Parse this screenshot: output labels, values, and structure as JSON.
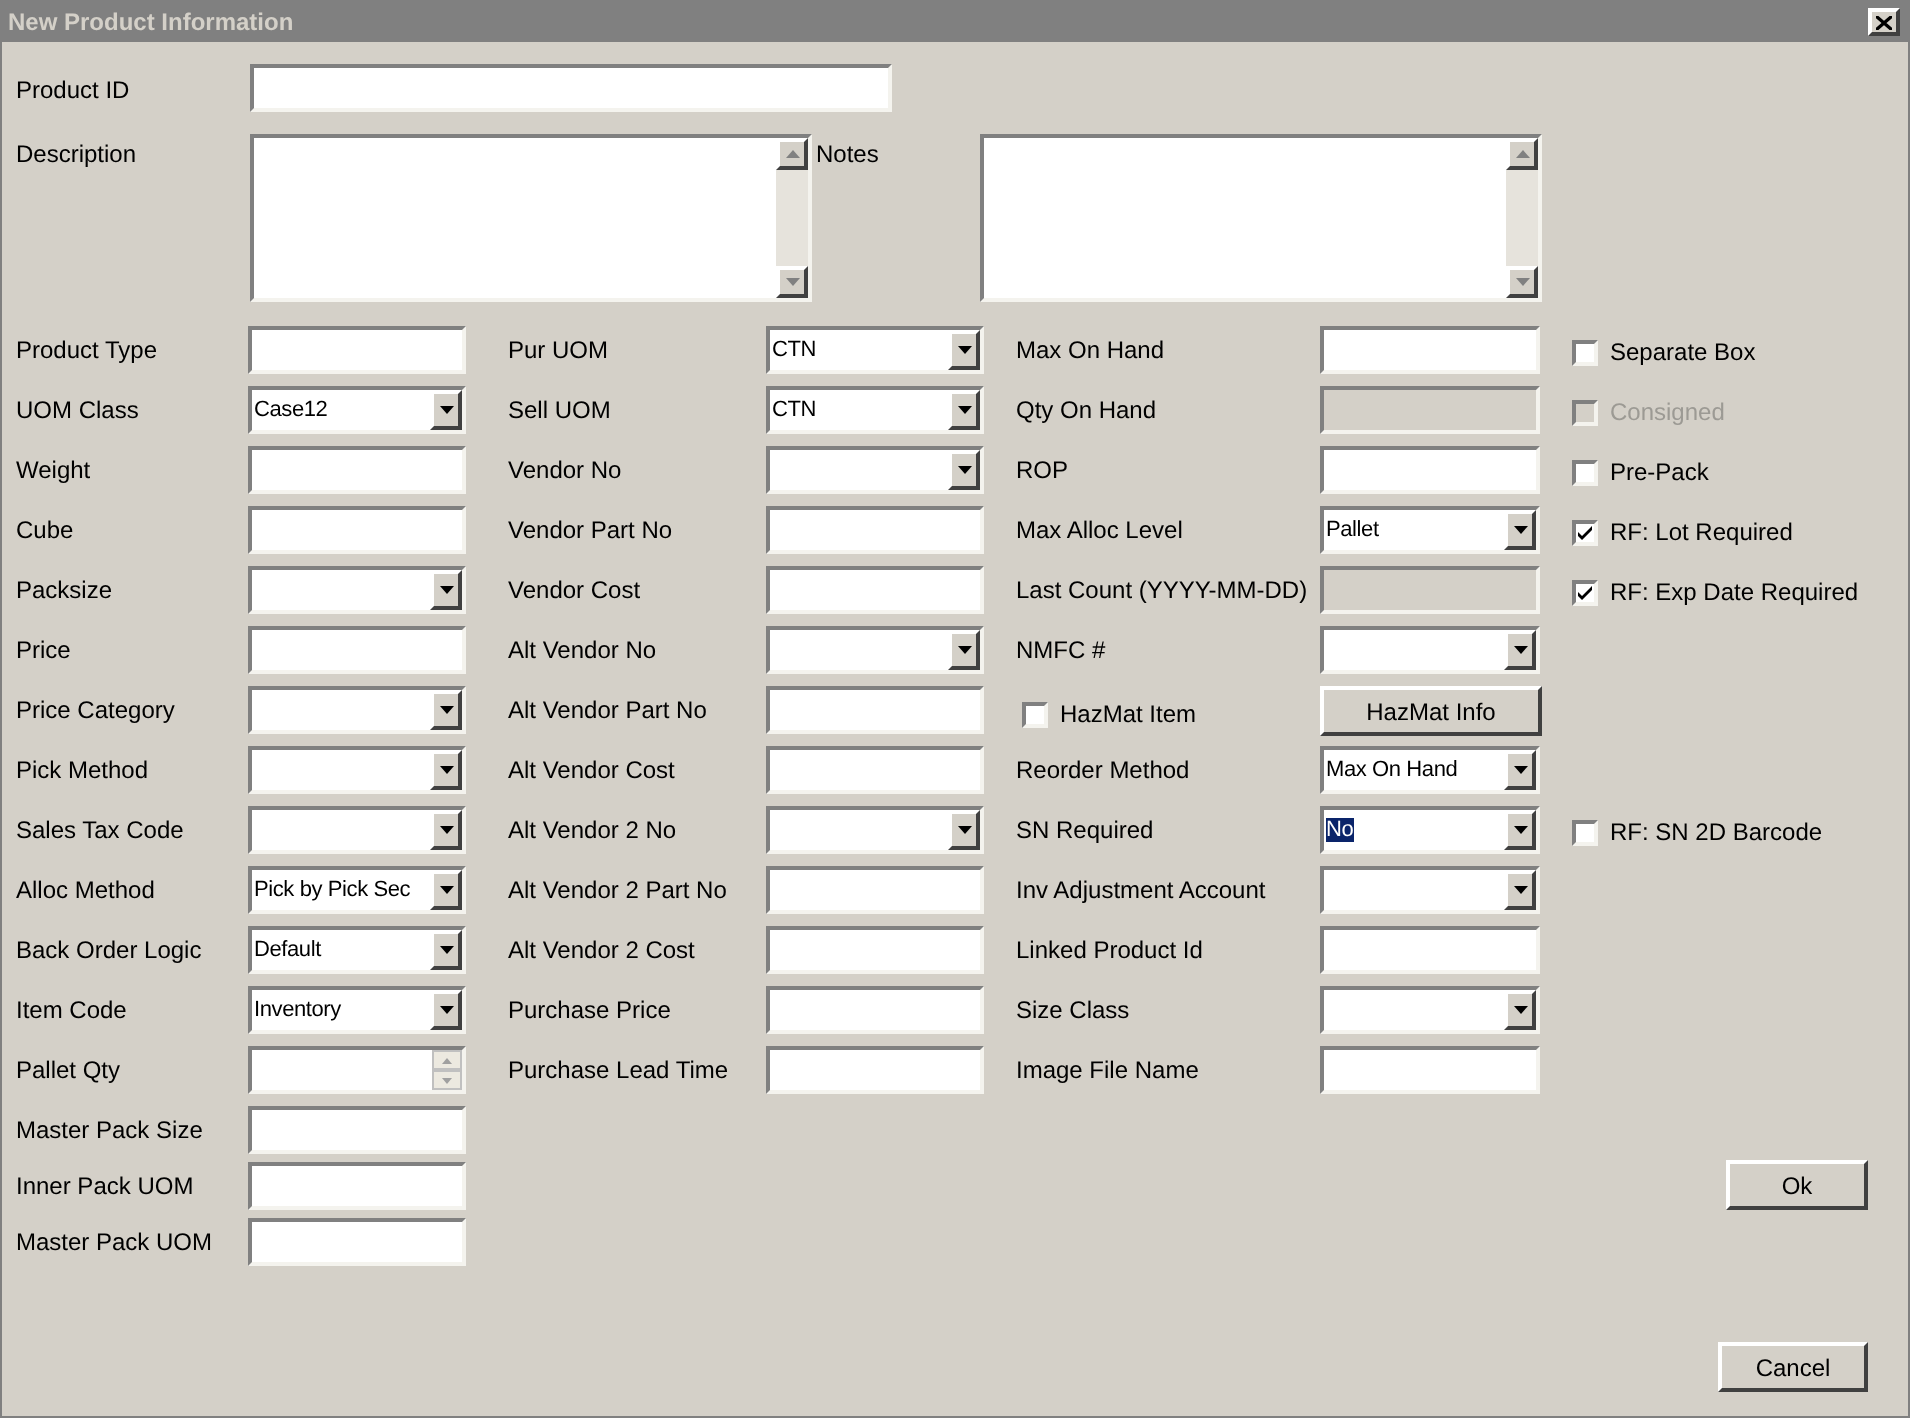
{
  "window": {
    "title": "New Product Information"
  },
  "product_id": {
    "label": "Product ID"
  },
  "description": {
    "label": "Description"
  },
  "notes": {
    "label": "Notes"
  },
  "rows": [
    {
      "col_a": {
        "kind": "text",
        "label": "Product Type"
      },
      "col_b": {
        "kind": "select",
        "label": "Pur UOM",
        "value": "CTN"
      },
      "col_c": {
        "kind": "text",
        "label": "Max On Hand"
      },
      "col_d": {
        "kind": "checkbox",
        "label": "Separate Box",
        "checked": false
      }
    },
    {
      "col_a": {
        "kind": "select",
        "label": "UOM Class",
        "value": "Case12"
      },
      "col_b": {
        "kind": "select",
        "label": "Sell UOM",
        "value": "CTN"
      },
      "col_c": {
        "kind": "text",
        "label": "Qty On Hand",
        "disabled": true
      },
      "col_d": {
        "kind": "checkbox",
        "label": "Consigned",
        "checked": false,
        "disabled": true
      }
    },
    {
      "col_a": {
        "kind": "text",
        "label": "Weight"
      },
      "col_b": {
        "kind": "select",
        "label": "Vendor No"
      },
      "col_c": {
        "kind": "text",
        "label": "ROP"
      },
      "col_d": {
        "kind": "checkbox",
        "label": "Pre-Pack",
        "checked": false
      }
    },
    {
      "col_a": {
        "kind": "text",
        "label": "Cube"
      },
      "col_b": {
        "kind": "text",
        "label": "Vendor Part No"
      },
      "col_c": {
        "kind": "select",
        "label": "Max Alloc Level",
        "value": "Pallet"
      },
      "col_d": {
        "kind": "checkbox",
        "label": "RF: Lot Required",
        "checked": true
      }
    },
    {
      "col_a": {
        "kind": "select",
        "label": "Packsize"
      },
      "col_b": {
        "kind": "text",
        "label": "Vendor Cost"
      },
      "col_c": {
        "kind": "text",
        "label": "Last Count (YYYY-MM-DD)",
        "disabled": true
      },
      "col_d": {
        "kind": "checkbox",
        "label": "RF: Exp Date Required",
        "checked": true
      }
    },
    {
      "col_a": {
        "kind": "text",
        "label": "Price"
      },
      "col_b": {
        "kind": "select",
        "label": "Alt Vendor No"
      },
      "col_c": {
        "kind": "select",
        "label": "NMFC #"
      }
    },
    {
      "col_a": {
        "kind": "select",
        "label": "Price Category"
      },
      "col_b": {
        "kind": "text",
        "label": "Alt Vendor Part No"
      },
      "col_c": {
        "kind": "checkbox_button",
        "label": "HazMat Item",
        "checked": false,
        "button": "HazMat Info"
      }
    },
    {
      "col_a": {
        "kind": "select",
        "label": "Pick Method"
      },
      "col_b": {
        "kind": "text",
        "label": "Alt Vendor Cost"
      },
      "col_c": {
        "kind": "select",
        "label": "Reorder Method",
        "value": "Max On Hand"
      }
    },
    {
      "col_a": {
        "kind": "select",
        "label": "Sales Tax Code"
      },
      "col_b": {
        "kind": "select",
        "label": "Alt Vendor 2 No"
      },
      "col_c": {
        "kind": "select",
        "label": "SN Required",
        "value": "No",
        "highlighted": true
      },
      "col_d": {
        "kind": "checkbox",
        "label": "RF: SN 2D Barcode",
        "checked": false
      }
    },
    {
      "col_a": {
        "kind": "select",
        "label": "Alloc Method",
        "value": "Pick by Pick Sec"
      },
      "col_b": {
        "kind": "text",
        "label": "Alt Vendor 2 Part No"
      },
      "col_c": {
        "kind": "select",
        "label": "Inv Adjustment Account"
      }
    },
    {
      "col_a": {
        "kind": "select",
        "label": "Back Order Logic",
        "value": "Default"
      },
      "col_b": {
        "kind": "text",
        "label": "Alt Vendor 2 Cost"
      },
      "col_c": {
        "kind": "text",
        "label": "Linked Product Id"
      }
    },
    {
      "col_a": {
        "kind": "select",
        "label": "Item Code",
        "value": "Inventory"
      },
      "col_b": {
        "kind": "text",
        "label": "Purchase Price"
      },
      "col_c": {
        "kind": "select",
        "label": "Size Class"
      }
    },
    {
      "col_a": {
        "kind": "spinner",
        "label": "Pallet Qty"
      },
      "col_b": {
        "kind": "text",
        "label": "Purchase Lead Time"
      },
      "col_c": {
        "kind": "text",
        "label": "Image File Name"
      }
    }
  ],
  "extra_rows": [
    {
      "kind": "text",
      "label": "Master Pack Size"
    },
    {
      "kind": "text",
      "label": "Inner Pack UOM"
    },
    {
      "kind": "text",
      "label": "Master Pack UOM"
    }
  ],
  "ok_button": {
    "label": "Ok"
  },
  "cancel_button": {
    "label": "Cancel"
  }
}
